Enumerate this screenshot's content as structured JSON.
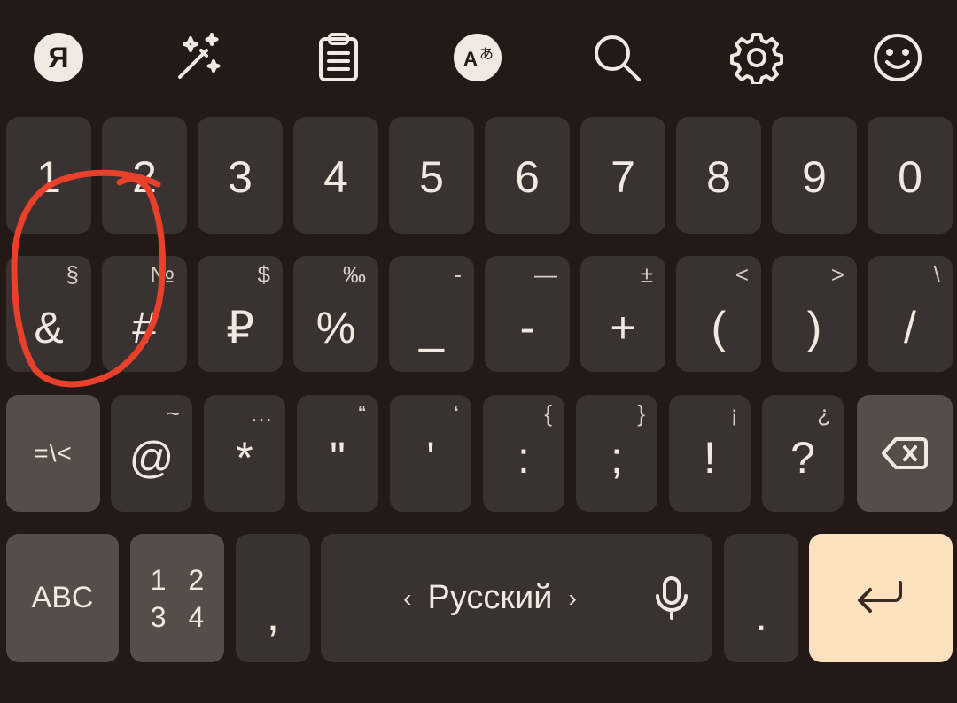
{
  "toolbar": {
    "yandex_logo_letter": "Я",
    "icons": [
      "yandex-logo-icon",
      "magic-wand-icon",
      "clipboard-icon",
      "translate-icon",
      "search-icon",
      "gear-icon",
      "emoji-icon"
    ]
  },
  "row1": [
    {
      "main": "1"
    },
    {
      "main": "2"
    },
    {
      "main": "3"
    },
    {
      "main": "4"
    },
    {
      "main": "5"
    },
    {
      "main": "6"
    },
    {
      "main": "7"
    },
    {
      "main": "8"
    },
    {
      "main": "9"
    },
    {
      "main": "0"
    }
  ],
  "row2": [
    {
      "main": "&",
      "sec": "§"
    },
    {
      "main": "#",
      "sec": "№"
    },
    {
      "main": "₽",
      "sec": "$"
    },
    {
      "main": "%",
      "sec": "‰"
    },
    {
      "main": "_",
      "sec": "-"
    },
    {
      "main": "-",
      "sec": "—"
    },
    {
      "main": "+",
      "sec": "±"
    },
    {
      "main": "(",
      "sec": "<"
    },
    {
      "main": ")",
      "sec": ">"
    },
    {
      "main": "/",
      "sec": "\\"
    }
  ],
  "row3": {
    "symbols_toggle": "=\\<",
    "keys": [
      {
        "main": "@",
        "sec": "~"
      },
      {
        "main": "*",
        "sec": "…"
      },
      {
        "main": "\"",
        "sec": "“"
      },
      {
        "main": "'",
        "sec": "‘"
      },
      {
        "main": ":",
        "sec": "{"
      },
      {
        "main": ";",
        "sec": "}"
      },
      {
        "main": "!",
        "sec": "¡"
      },
      {
        "main": "?",
        "sec": "¿"
      }
    ]
  },
  "row4": {
    "abc_label": "ABC",
    "numpad_line1": "1 2",
    "numpad_line2": "3 4",
    "comma": ",",
    "space_label": "Русский",
    "chevron_left": "‹",
    "chevron_right": "›",
    "period": "."
  },
  "colors": {
    "background": "#231a18",
    "key": "#3a3230",
    "function_key": "#564d49",
    "enter_key": "#fde0bd",
    "annotation": "#e8402a"
  }
}
